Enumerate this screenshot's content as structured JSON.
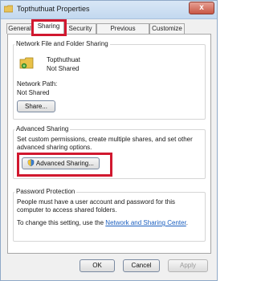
{
  "window": {
    "title": "Topthuthuat Properties",
    "close_label": "x"
  },
  "tabs": [
    {
      "label": "General"
    },
    {
      "label": "Sharing"
    },
    {
      "label": "Security"
    },
    {
      "label": "Previous Versions"
    },
    {
      "label": "Customize"
    }
  ],
  "network_sharing": {
    "heading": "Network File and Folder Sharing",
    "folder_name": "Topthuthuat",
    "folder_status": "Not Shared",
    "path_label": "Network Path:",
    "path_value": "Not Shared",
    "share_button": "Share..."
  },
  "advanced_sharing": {
    "heading": "Advanced Sharing",
    "description": "Set custom permissions, create multiple shares, and set other advanced sharing options.",
    "button": "Advanced Sharing..."
  },
  "password_protection": {
    "heading": "Password Protection",
    "description": "People must have a user account and password for this computer to access shared folders.",
    "change_text": "To change this setting, use the ",
    "link_text": "Network and Sharing Center",
    "change_suffix": "."
  },
  "footer": {
    "ok": "OK",
    "cancel": "Cancel",
    "apply": "Apply"
  },
  "colors": {
    "highlight": "#d1182f",
    "link": "#1a5ebf"
  }
}
